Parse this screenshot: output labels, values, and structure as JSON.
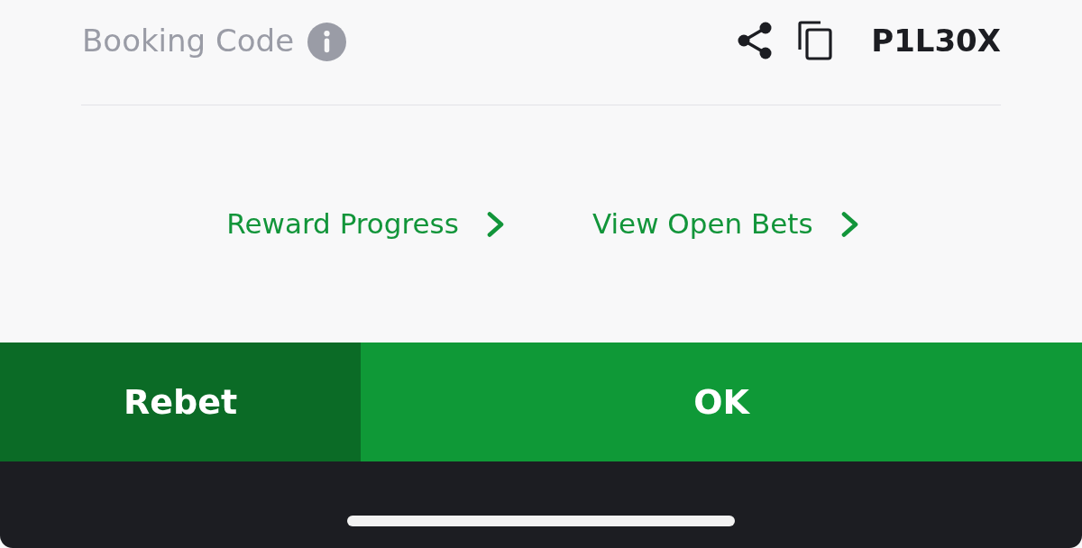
{
  "booking": {
    "label": "Booking Code",
    "code": "P1L30X"
  },
  "links": [
    {
      "label": "Reward Progress"
    },
    {
      "label": "View Open Bets"
    }
  ],
  "buttons": [
    {
      "label": "Rebet",
      "kind": "secondary"
    },
    {
      "label": "OK",
      "kind": "primary"
    }
  ]
}
